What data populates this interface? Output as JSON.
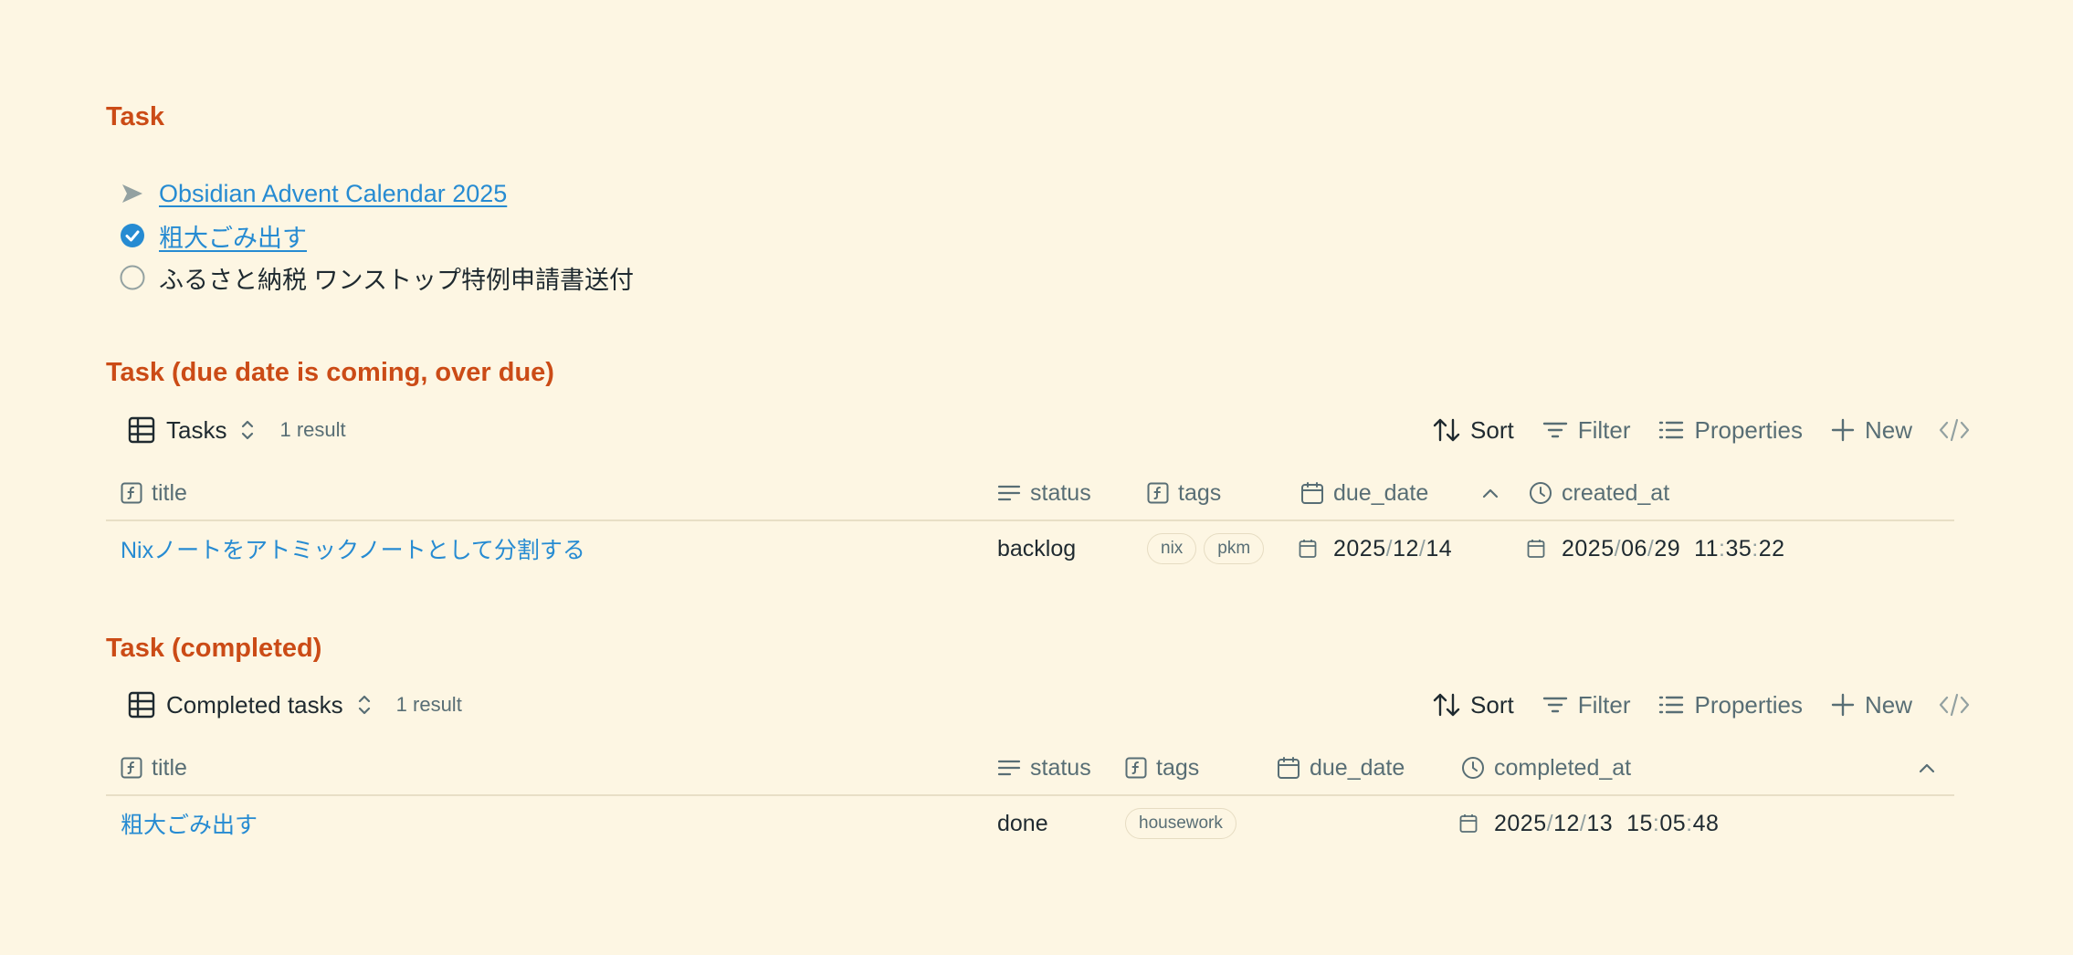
{
  "section1": {
    "heading": "Task",
    "items": [
      {
        "text": "Obsidian Advent Calendar 2025",
        "state": "in-progress",
        "link": true
      },
      {
        "text": "粗大ごみ出す",
        "state": "done",
        "link": true
      },
      {
        "text": "ふるさと納税 ワンストップ特例申請書送付",
        "state": "todo",
        "link": false
      }
    ]
  },
  "section2": {
    "heading": "Task (due date is coming, over due)",
    "view_name": "Tasks",
    "result_count": "1 result",
    "toolbar": {
      "sort": "Sort",
      "filter": "Filter",
      "properties": "Properties",
      "new": "New"
    },
    "columns": {
      "title": "title",
      "status": "status",
      "tags": "tags",
      "due_date": "due_date",
      "created_at": "created_at"
    },
    "rows": [
      {
        "title": "Nixノートをアトミックノートとして分割する",
        "status": "backlog",
        "tags": [
          "nix",
          "pkm"
        ],
        "due_date": {
          "y": "2025",
          "m": "12",
          "d": "14"
        },
        "created_at": {
          "y": "2025",
          "m": "06",
          "d": "29",
          "h": "11",
          "min": "35",
          "s": "22"
        }
      }
    ]
  },
  "section3": {
    "heading": "Task (completed)",
    "view_name": "Completed tasks",
    "result_count": "1 result",
    "toolbar": {
      "sort": "Sort",
      "filter": "Filter",
      "properties": "Properties",
      "new": "New"
    },
    "columns": {
      "title": "title",
      "status": "status",
      "tags": "tags",
      "due_date": "due_date",
      "completed_at": "completed_at"
    },
    "rows": [
      {
        "title": "粗大ごみ出す",
        "status": "done",
        "tags": [
          "housework"
        ],
        "completed_at": {
          "y": "2025",
          "m": "12",
          "d": "13",
          "h": "15",
          "min": "05",
          "s": "48"
        }
      }
    ]
  },
  "colors": {
    "heading": "#cb4b16",
    "link": "#268bd2",
    "background": "#fdf6e3",
    "muted": "#586e75"
  }
}
